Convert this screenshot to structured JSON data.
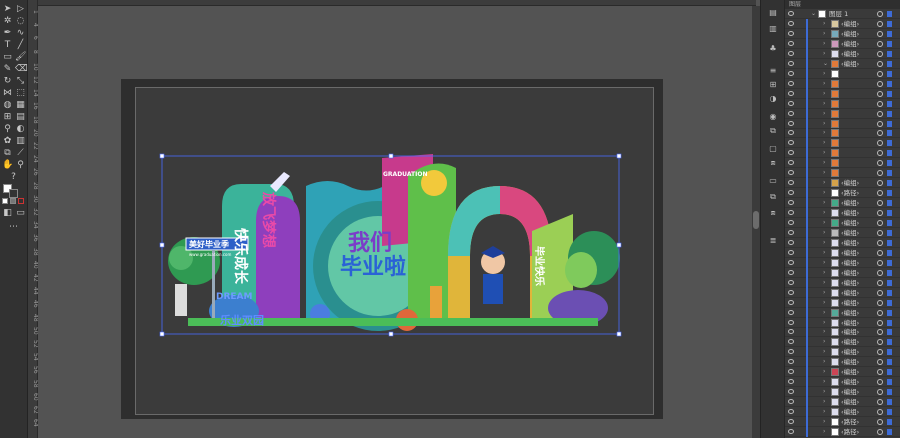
{
  "app": {
    "panel_tab": "图层"
  },
  "ruler": {
    "marks": [
      "1",
      "4",
      "6",
      "8",
      "10",
      "12",
      "14",
      "16",
      "18",
      "20",
      "22",
      "24",
      "26",
      "28",
      "30",
      "32",
      "34",
      "36",
      "38",
      "40",
      "42",
      "44",
      "46",
      "48",
      "50",
      "52",
      "54",
      "56",
      "58",
      "60",
      "62",
      "64"
    ]
  },
  "artwork": {
    "sign_text": "美好毕业季",
    "sign_subtext": "www.graduation.com",
    "vertical_text_left": "快乐成长",
    "vertical_text_right": "放飞梦想",
    "title_wo": "我们",
    "title_graduate": "毕业啦",
    "banner_small": "GRADUATION",
    "dream": "DREAM",
    "kindergarten": "乐业双园",
    "arch_right_text": "毕业快乐"
  },
  "layers": {
    "top_layer": "图层 1",
    "rows": [
      {
        "name": "编组",
        "thumb": "#d8c8a0",
        "expanded": false
      },
      {
        "name": "编组",
        "thumb": "#7ab",
        "expanded": false
      },
      {
        "name": "编组",
        "thumb": "#c9b",
        "expanded": false
      },
      {
        "name": "编组",
        "thumb": "#dde",
        "expanded": false
      },
      {
        "name": "编组",
        "thumb": "#e07a3a",
        "expanded": true
      },
      {
        "name": "",
        "thumb": "#ffffff",
        "expanded": false
      },
      {
        "name": "",
        "thumb": "#e07a3a",
        "expanded": false
      },
      {
        "name": "",
        "thumb": "#e07a3a",
        "expanded": false
      },
      {
        "name": "",
        "thumb": "#e07a3a",
        "expanded": false
      },
      {
        "name": "",
        "thumb": "#e07a3a",
        "expanded": false
      },
      {
        "name": "",
        "thumb": "#e07a3a",
        "expanded": false
      },
      {
        "name": "",
        "thumb": "#e07a3a",
        "expanded": false
      },
      {
        "name": "",
        "thumb": "#e07a3a",
        "expanded": false
      },
      {
        "name": "",
        "thumb": "#e07a3a",
        "expanded": false
      },
      {
        "name": "",
        "thumb": "#e07a3a",
        "expanded": false
      },
      {
        "name": "",
        "thumb": "#e07a3a",
        "expanded": false
      },
      {
        "name": "编组",
        "thumb": "#d4a24a",
        "expanded": false
      },
      {
        "name": "路径",
        "thumb": "#ffffff",
        "expanded": false
      },
      {
        "name": "编组",
        "thumb": "#4a8",
        "expanded": false
      },
      {
        "name": "编组",
        "thumb": "#dde",
        "expanded": false
      },
      {
        "name": "编组",
        "thumb": "#4a8",
        "expanded": false
      },
      {
        "name": "编组",
        "thumb": "#bbb",
        "expanded": false
      },
      {
        "name": "编组",
        "thumb": "#dde",
        "expanded": false
      },
      {
        "name": "编组",
        "thumb": "#dde",
        "expanded": false
      },
      {
        "name": "编组",
        "thumb": "#dde",
        "expanded": false
      },
      {
        "name": "编组",
        "thumb": "#dde",
        "expanded": false
      },
      {
        "name": "编组",
        "thumb": "#dde",
        "expanded": false
      },
      {
        "name": "编组",
        "thumb": "#dde",
        "expanded": false
      },
      {
        "name": "编组",
        "thumb": "#dde",
        "expanded": false
      },
      {
        "name": "编组",
        "thumb": "#5a9",
        "expanded": false
      },
      {
        "name": "编组",
        "thumb": "#dde",
        "expanded": false
      },
      {
        "name": "编组",
        "thumb": "#dde",
        "expanded": false
      },
      {
        "name": "编组",
        "thumb": "#dde",
        "expanded": false
      },
      {
        "name": "编组",
        "thumb": "#dde",
        "expanded": false
      },
      {
        "name": "编组",
        "thumb": "#dde",
        "expanded": false
      },
      {
        "name": "编组",
        "thumb": "#c45",
        "expanded": false
      },
      {
        "name": "编组",
        "thumb": "#dde",
        "expanded": false
      },
      {
        "name": "编组",
        "thumb": "#dde",
        "expanded": false
      },
      {
        "name": "编组",
        "thumb": "#dde",
        "expanded": false
      },
      {
        "name": "编组",
        "thumb": "#dde",
        "expanded": false
      },
      {
        "name": "路径",
        "thumb": "#ffffff",
        "expanded": false
      },
      {
        "name": "路径",
        "thumb": "#ffffff",
        "expanded": false
      }
    ]
  },
  "colors": {
    "selection": "#4a6bff",
    "layer_bar": "#3d6bd6"
  }
}
